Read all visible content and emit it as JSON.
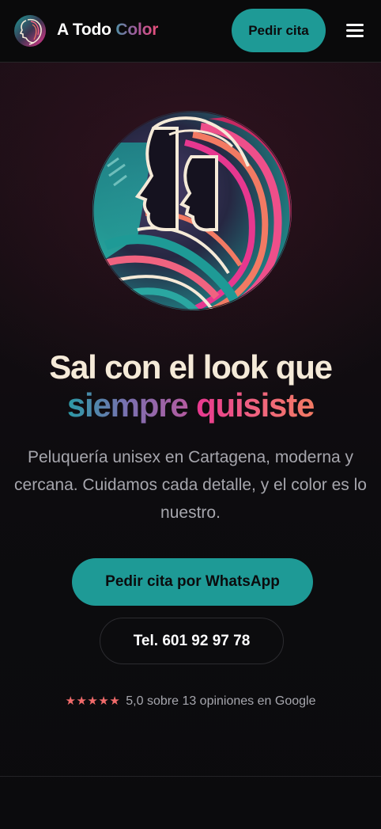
{
  "header": {
    "brand_word1": "A Todo",
    "brand_word2": "Color",
    "cta_label": "Pedir cita",
    "menu_icon": "hamburger-menu-icon",
    "logo_icon": "salon-profiles-logo"
  },
  "hero": {
    "image_icon": "two-profiles-colored-hair-illustration",
    "title_line1": "Sal con el look que",
    "title_word_a": "siempre",
    "title_word_b": "quisiste",
    "subtitle": "Peluquería unisex en Cartagena, moderna y cercana. Cuidamos cada detalle, y el color es lo nuestro.",
    "primary_button": "Pedir cita por WhatsApp",
    "secondary_button": "Tel. 601 92 97 78",
    "rating_stars": "★★★★★",
    "rating_value": 5,
    "rating_text": "5,0 sobre 13 opiniones en Google"
  },
  "colors": {
    "accent_teal": "#1e9a96",
    "accent_pink": "#e7378f",
    "accent_coral": "#f27a63",
    "star_color": "#f16b6b",
    "background": "#0b0b0d"
  }
}
